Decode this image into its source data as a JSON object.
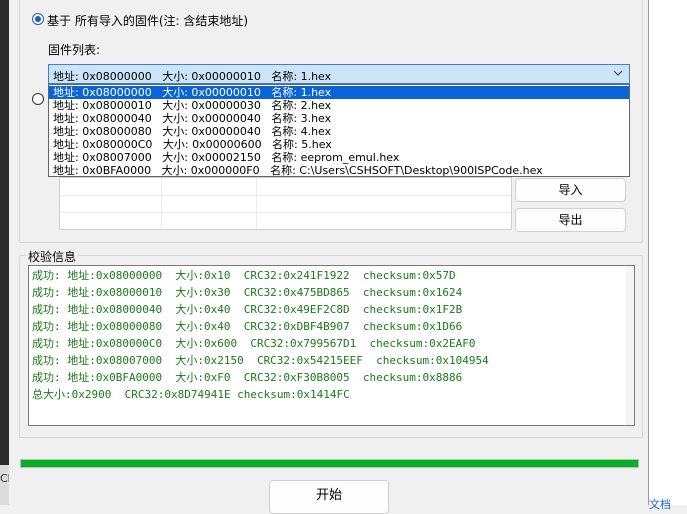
{
  "source_option": {
    "label": "基于 所有导入的固件(注: 含结束地址)",
    "checked": true
  },
  "firmware_list": {
    "label": "固件列表:",
    "selected": "地址: 0x08000000   大小: 0x00000010   名称: 1.hex",
    "items": [
      "地址: 0x08000000   大小: 0x00000010   名称: 1.hex",
      "地址: 0x08000010   大小: 0x00000030   名称: 2.hex",
      "地址: 0x08000040   大小: 0x00000040   名称: 3.hex",
      "地址: 0x08000080   大小: 0x00000040   名称: 4.hex",
      "地址: 0x080000C0   大小: 0x00000600   名称: 5.hex",
      "地址: 0x08007000   大小: 0x00002150   名称: eeprom_emul.hex",
      "地址: 0x0BFA0000   大小: 0x000000F0   名称: C:\\Users\\CSHSOFT\\Desktop\\900ISPCode.hex"
    ]
  },
  "buttons": {
    "import": "导入",
    "export": "导出",
    "start": "开始"
  },
  "verify": {
    "title": "校验信息",
    "lines": [
      "成功: 地址:0x08000000  大小:0x10  CRC32:0x241F1922  checksum:0x57D",
      "成功: 地址:0x08000010  大小:0x30  CRC32:0x475BD865  checksum:0x1624",
      "成功: 地址:0x08000040  大小:0x40  CRC32:0x49EF2C8D  checksum:0x1F2B",
      "成功: 地址:0x08000080  大小:0x40  CRC32:0xDBF4B907  checksum:0x1D66",
      "成功: 地址:0x080000C0  大小:0x600  CRC32:0x799567D1  checksum:0x2EAF0",
      "成功: 地址:0x08007000  大小:0x2150  CRC32:0x54215EEF  checksum:0x104954",
      "成功: 地址:0x0BFA0000  大小:0xF0  CRC32:0xF30B8005  checksum:0x8886",
      "总大小:0x2900  CRC32:0x8D74941E checksum:0x1414FC"
    ]
  },
  "progress": {
    "fraction": 1.0,
    "color": "#06b025"
  },
  "edge": {
    "left_text": "Ch",
    "right_text": "文档"
  }
}
